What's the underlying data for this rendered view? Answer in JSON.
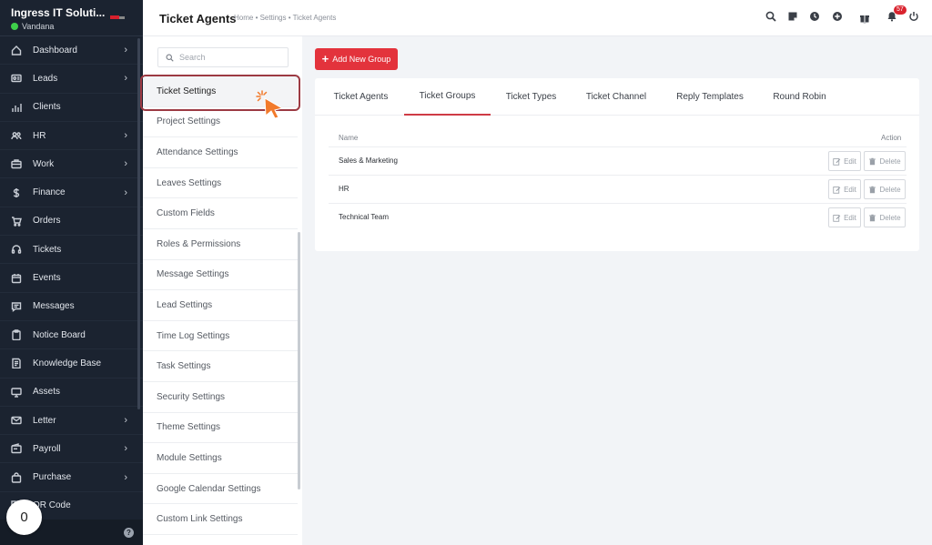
{
  "sidebar": {
    "company": "Ingress IT Soluti...",
    "user": "Vandana",
    "items": [
      {
        "label": "Dashboard",
        "icon": "home-icon",
        "has_submenu": true
      },
      {
        "label": "Leads",
        "icon": "id-card-icon",
        "has_submenu": true
      },
      {
        "label": "Clients",
        "icon": "bar-chart-icon",
        "has_submenu": false
      },
      {
        "label": "HR",
        "icon": "people-icon",
        "has_submenu": true
      },
      {
        "label": "Work",
        "icon": "briefcase-icon",
        "has_submenu": true
      },
      {
        "label": "Finance",
        "icon": "dollar-icon",
        "has_submenu": true
      },
      {
        "label": "Orders",
        "icon": "cart-icon",
        "has_submenu": false
      },
      {
        "label": "Tickets",
        "icon": "headset-icon",
        "has_submenu": false
      },
      {
        "label": "Events",
        "icon": "calendar-icon",
        "has_submenu": false
      },
      {
        "label": "Messages",
        "icon": "chat-icon",
        "has_submenu": false
      },
      {
        "label": "Notice Board",
        "icon": "clipboard-icon",
        "has_submenu": false
      },
      {
        "label": "Knowledge Base",
        "icon": "book-icon",
        "has_submenu": false
      },
      {
        "label": "Assets",
        "icon": "monitor-icon",
        "has_submenu": false
      },
      {
        "label": "Letter",
        "icon": "envelope-icon",
        "has_submenu": true
      },
      {
        "label": "Payroll",
        "icon": "wallet-icon",
        "has_submenu": true
      },
      {
        "label": "Purchase",
        "icon": "bag-icon",
        "has_submenu": true
      },
      {
        "label": "QR Code",
        "icon": "qr-code-icon",
        "has_submenu": false
      }
    ],
    "counter": "0",
    "help": "?"
  },
  "header": {
    "title": "Ticket Agents",
    "breadcrumb": "Home • Settings • Ticket Agents",
    "notification_count": "57"
  },
  "settings_menu": {
    "search_placeholder": "Search",
    "active_index": 0,
    "items": [
      "Ticket Settings",
      "Project Settings",
      "Attendance Settings",
      "Leaves Settings",
      "Custom Fields",
      "Roles & Permissions",
      "Message Settings",
      "Lead Settings",
      "Time Log Settings",
      "Task Settings",
      "Security Settings",
      "Theme Settings",
      "Module Settings",
      "Google Calendar Settings",
      "Custom Link Settings"
    ]
  },
  "main": {
    "add_button_label": "Add New Group",
    "tabs": [
      {
        "label": "Ticket Agents",
        "active": false
      },
      {
        "label": "Ticket Groups",
        "active": true
      },
      {
        "label": "Ticket Types",
        "active": false
      },
      {
        "label": "Ticket Channel",
        "active": false
      },
      {
        "label": "Reply Templates",
        "active": false
      },
      {
        "label": "Round Robin",
        "active": false
      }
    ],
    "table": {
      "columns": [
        "Name",
        "Action"
      ],
      "rows": [
        {
          "name": "Sales & Marketing"
        },
        {
          "name": "HR"
        },
        {
          "name": "Technical Team"
        }
      ],
      "edit_label": "Edit",
      "delete_label": "Delete"
    }
  },
  "colors": {
    "sidebar_bg": "#1b2330",
    "accent": "#e3333c",
    "active_tab_underline": "#cf3b45",
    "highlight_border": "#9c3a43",
    "cursor": "#f27a2b"
  }
}
